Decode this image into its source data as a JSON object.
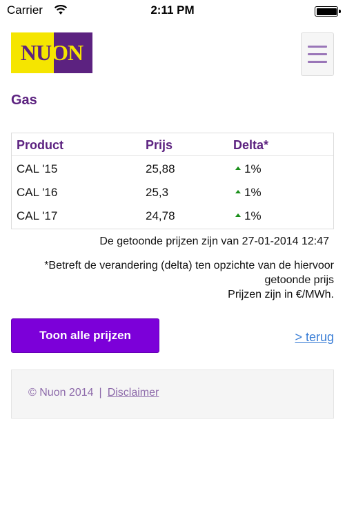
{
  "status_bar": {
    "carrier": "Carrier",
    "time": "2:11 PM",
    "wifi_icon": "wifi-icon",
    "battery_icon": "battery-icon"
  },
  "header": {
    "logo_letters": [
      "N",
      "U",
      "O",
      "N"
    ],
    "logo_colors": {
      "yellow": "#f5e500",
      "purple": "#5c2280"
    },
    "menu_icon": "hamburger-menu-icon"
  },
  "page": {
    "title": "Gas"
  },
  "table": {
    "headers": [
      "Product",
      "Prijs",
      "Delta*"
    ],
    "rows": [
      {
        "product": "CAL '15",
        "price": "25,88",
        "delta": "1%",
        "direction": "up"
      },
      {
        "product": "CAL '16",
        "price": "25,3",
        "delta": "1%",
        "direction": "up"
      },
      {
        "product": "CAL '17",
        "price": "24,78",
        "delta": "1%",
        "direction": "up"
      }
    ],
    "delta_up_color": "#1a8f1a"
  },
  "info": {
    "timestamp_text": "De getoonde prijzen zijn van 27-01-2014 12:47",
    "delta_note": "*Betreft de verandering (delta) ten opzichte van de hiervoor getoonde prijs",
    "unit_note": "Prijzen zijn in €/MWh."
  },
  "actions": {
    "show_all_label": "Toon alle prijzen",
    "back_label": "> terug"
  },
  "footer": {
    "copyright": "© Nuon 2014",
    "separator": "|",
    "disclaimer_label": "Disclaimer"
  },
  "colors": {
    "brand_purple": "#5c2280",
    "button_purple": "#7c00d9",
    "link_blue": "#3a7ed6"
  }
}
